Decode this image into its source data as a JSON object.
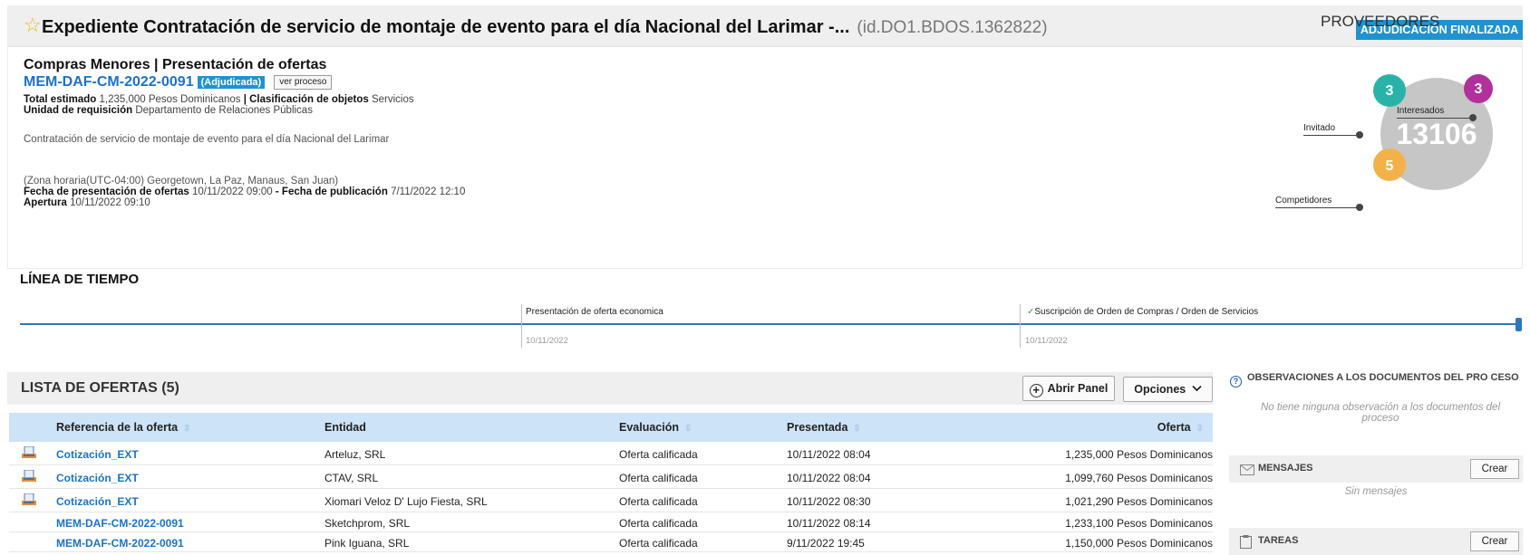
{
  "header": {
    "title": "Expediente  Contratación de servicio de montaje de evento para el día Nacional del Larimar -...",
    "id": "(id.DO1.BDOS.1362822)",
    "status": "ADJUDICACIÓN FINALIZADA"
  },
  "process": {
    "type": "Compras Menores | Presentación de ofertas",
    "reference": "MEM-DAF-CM-2022-0091",
    "badge": "(Adjudicada)",
    "ver_proceso": "ver proceso",
    "total_label": "Total estimado",
    "total_value": "1,235,000 Pesos Dominicanos",
    "clasificacion_label": "| Clasificación de objetos",
    "clasificacion_value": "Servicios",
    "unidad_label": "Unidad de requisición",
    "unidad_value": "Departamento de Relaciones Públicas",
    "description": "Contratación de servicio de montaje de evento para el día Nacional del Larimar",
    "timezone": "(Zona horaria(UTC-04:00) Georgetown, La Paz, Manaus, San Juan)",
    "fecha_ofertas_label": "Fecha de presentación de ofertas",
    "fecha_ofertas_value": "10/11/2022 09:00",
    "fecha_pub_label": "- Fecha de publicación",
    "fecha_pub_value": "7/11/2022 12:10",
    "apertura_label": "Apertura",
    "apertura_value": "10/11/2022 09:10"
  },
  "proveedores": {
    "title": "PROVEEDORES",
    "total": "13106",
    "invitado_label": "Invitado",
    "invitado_count": "3",
    "interesados_label": "Interesados",
    "interesados_count": "3",
    "competidores_label": "Competidores",
    "competidores_count": "5",
    "colors": {
      "invitado": "#29b3a8",
      "interesados": "#b0309c",
      "competidores": "#f3b249",
      "total": "#c6c6c6"
    }
  },
  "timeline": {
    "title": "LÍNEA DE TIEMPO",
    "events": [
      {
        "label": "Presentación de oferta economica",
        "date": "10/11/2022",
        "check": ""
      },
      {
        "label": "Suscripción de Orden de Compras / Orden de Servicios",
        "date": "10/11/2022",
        "check": "✓"
      }
    ]
  },
  "offers": {
    "title": "LISTA DE OFERTAS (5)",
    "abrir_panel": "Abrir Panel",
    "opciones": "Opciones",
    "columns": [
      "Referencia de la oferta",
      "Entidad",
      "Evaluación",
      "Presentada",
      "Oferta"
    ],
    "rows": [
      {
        "ref": "Cotización_EXT",
        "entidad": "Arteluz, SRL",
        "evaluacion": "Oferta calificada",
        "presentada": "10/11/2022 08:04",
        "oferta": "1,235,000 Pesos Dominicanos",
        "icon": "document-icon"
      },
      {
        "ref": "Cotización_EXT",
        "entidad": "CTAV, SRL",
        "evaluacion": "Oferta calificada",
        "presentada": "10/11/2022 08:04",
        "oferta": "1,099,760 Pesos Dominicanos",
        "icon": "document-icon"
      },
      {
        "ref": "Cotización_EXT",
        "entidad": "Xiomari Veloz D' Lujo Fiesta, SRL",
        "evaluacion": "Oferta calificada",
        "presentada": "10/11/2022 08:30",
        "oferta": "1,021,290 Pesos Dominicanos",
        "icon": "document-icon"
      },
      {
        "ref": "MEM-DAF-CM-2022-0091",
        "entidad": "Sketchprom, SRL",
        "evaluacion": "Oferta calificada",
        "presentada": "10/11/2022 08:14",
        "oferta": "1,233,100 Pesos Dominicanos",
        "icon": ""
      },
      {
        "ref": "MEM-DAF-CM-2022-0091",
        "entidad": "Pink Iguana, SRL",
        "evaluacion": "Oferta calificada",
        "presentada": "9/11/2022 19:45",
        "oferta": "1,150,000 Pesos Dominicanos",
        "icon": ""
      }
    ]
  },
  "sidebar": {
    "obs_title": "OBSERVACIONES A LOS DOCUMENTOS DEL PRO CESO",
    "obs_empty": "No tiene ninguna observación a los documentos del proceso",
    "mensajes_title": "MENSAJES",
    "mensajes_empty": "Sin mensajes",
    "tareas_title": "TAREAS",
    "crear": "Crear"
  }
}
